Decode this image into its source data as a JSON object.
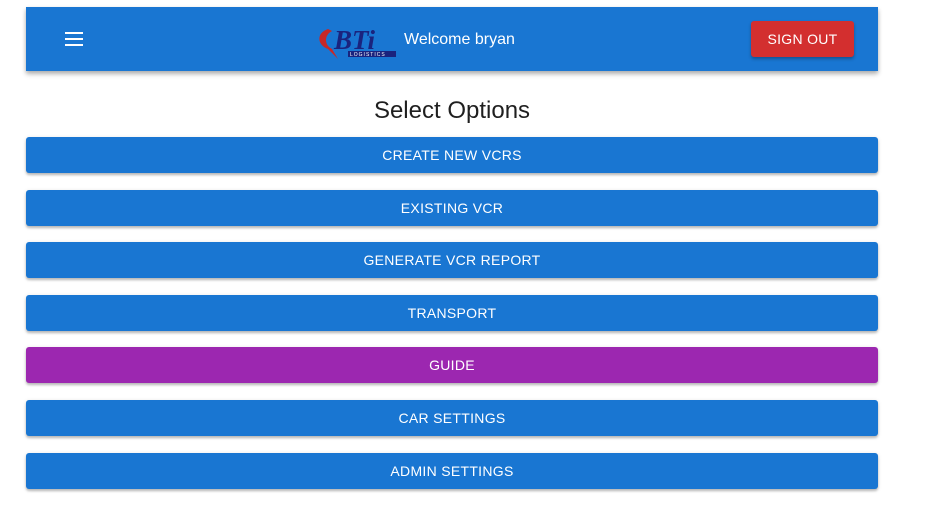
{
  "header": {
    "menu_icon": "hamburger-menu-icon",
    "logo_text": "BTi",
    "logo_subtext": "LOGISTICS",
    "welcome_text": "Welcome bryan",
    "signout_label": "SIGN OUT"
  },
  "main": {
    "heading": "Select Options",
    "options": [
      {
        "label": "CREATE NEW VCRS",
        "color": "#1976d2"
      },
      {
        "label": "EXISTING VCR",
        "color": "#1976d2"
      },
      {
        "label": "GENERATE VCR REPORT",
        "color": "#1976d2"
      },
      {
        "label": "TRANSPORT",
        "color": "#1976d2"
      },
      {
        "label": "GUIDE",
        "color": "#9c27b0"
      },
      {
        "label": "CAR SETTINGS",
        "color": "#1976d2"
      },
      {
        "label": "ADMIN SETTINGS",
        "color": "#1976d2"
      }
    ]
  },
  "colors": {
    "primary": "#1976d2",
    "secondary": "#9c27b0",
    "danger": "#d32f2f"
  }
}
